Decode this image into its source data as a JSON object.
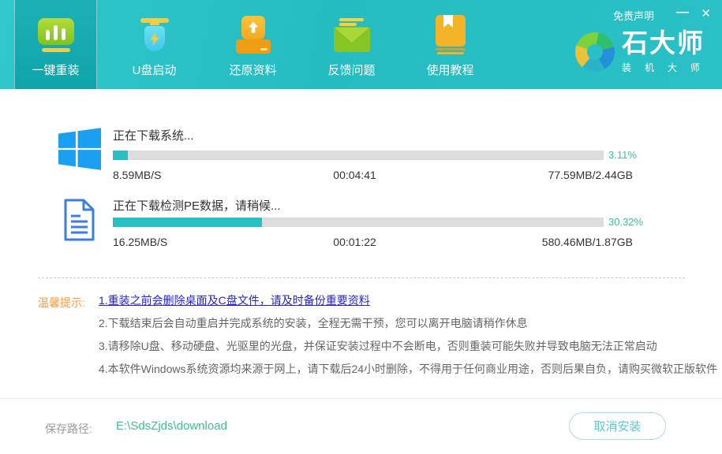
{
  "titlebar": {
    "disclaimer": "免责声明",
    "minimize_icon": "—",
    "close_icon": "✕"
  },
  "logo": {
    "title": "石大师",
    "subtitle": "装机大师"
  },
  "nav": {
    "tabs": [
      {
        "label": "一键重装",
        "icon": "bar-chart-icon",
        "active": true
      },
      {
        "label": "U盘启动",
        "icon": "usb-boot-icon",
        "active": false
      },
      {
        "label": "还原资料",
        "icon": "restore-box-icon",
        "active": false
      },
      {
        "label": "反馈问题",
        "icon": "feedback-mail-icon",
        "active": false
      },
      {
        "label": "使用教程",
        "icon": "tutorial-book-icon",
        "active": false
      }
    ]
  },
  "downloads": [
    {
      "icon": "windows-logo-icon",
      "label": "正在下载系统...",
      "percent": "3.11%",
      "percent_value": 3.11,
      "speed": "8.59MB/S",
      "time": "00:04:41",
      "size": "77.59MB/2.44GB"
    },
    {
      "icon": "document-icon",
      "label": "正在下载检测PE数据，请稍候...",
      "percent": "30.32%",
      "percent_value": 30.32,
      "speed": "16.25MB/S",
      "time": "00:01:22",
      "size": "580.46MB/1.87GB"
    }
  ],
  "tips": {
    "title": "温馨提示:",
    "items": [
      {
        "text": "1.重装之前会删除桌面及C盘文件，请及时备份重要资料",
        "emphasis": true
      },
      {
        "text": "2.下载结束后会自动重启并完成系统的安装，全程无需干预，您可以离开电脑请稍作休息",
        "emphasis": false
      },
      {
        "text": "3.请移除U盘、移动硬盘、光驱里的光盘，并保证安装过程中不会断电，否则重装可能失败并导致电脑无法正常启动",
        "emphasis": false
      },
      {
        "text": "4.本软件Windows系统资源均来源于网上，请下载后24小时删除，不得用于任何商业用途，否则后果自负，请购买微软正版软件",
        "emphasis": false
      }
    ]
  },
  "footer": {
    "path_label": "保存路径:",
    "path": "E:\\SdsZjds\\download",
    "cancel_button": "取消安装"
  },
  "colors": {
    "header_teal": "#29c1c6",
    "active_tab_teal": "#14a9ae",
    "progress_fill": "#2abfc4",
    "progress_track": "#dcdcdc",
    "percent_green": "#3dbe93",
    "tips_orange": "#ff9b3d",
    "tip_highlight_blue": "#2524ce",
    "windows_blue": "#1a9ff1"
  }
}
